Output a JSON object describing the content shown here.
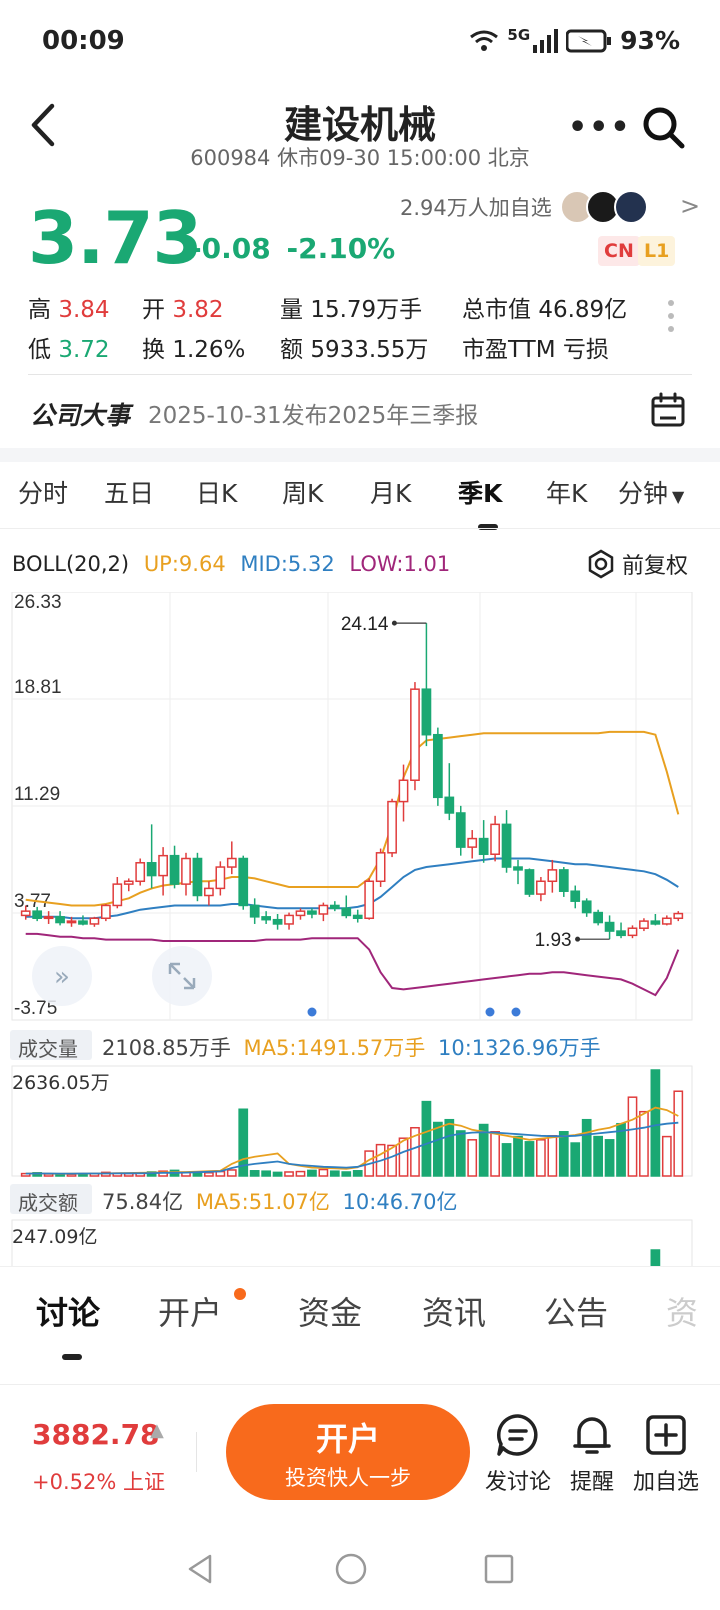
{
  "status": {
    "time": "00:09",
    "network": "5G",
    "battery": "93%"
  },
  "header": {
    "title": "建设机械",
    "subtitle": "600984 休市09-30 15:00:00 北京"
  },
  "quote": {
    "price": "3.73",
    "change": "-0.08",
    "change_pct": "-2.10%",
    "followers": "2.94万人加自选",
    "tags": [
      "CN",
      "L1"
    ]
  },
  "stats": [
    {
      "label": "高",
      "value": "3.84",
      "color": "red"
    },
    {
      "label": "开",
      "value": "3.82",
      "color": "red"
    },
    {
      "label": "量",
      "value": "15.79万手",
      "color": "dark"
    },
    {
      "label": "总市值",
      "value": "46.89亿",
      "color": "dark"
    },
    {
      "label": "低",
      "value": "3.72",
      "color": "green"
    },
    {
      "label": "换",
      "value": "1.26%",
      "color": "dark"
    },
    {
      "label": "额",
      "value": "5933.55万",
      "color": "dark"
    },
    {
      "label": "市盈TTM",
      "value": "亏损",
      "color": "dark"
    }
  ],
  "event": {
    "title": "公司大事",
    "text": "2025-10-31发布2025年三季报"
  },
  "period_tabs": [
    "分时",
    "五日",
    "日K",
    "周K",
    "月K",
    "季K",
    "年K",
    "分钟"
  ],
  "active_period": "季K",
  "indicator": {
    "name": "BOLL(20,2)",
    "up": "UP:9.64",
    "mid": "MID:5.32",
    "low": "LOW:1.01",
    "adjust": "前复权"
  },
  "colors": {
    "up": "#e03c3c",
    "down": "#1aa873",
    "boll_up": "#e8a020",
    "boll_mid": "#2f7fc1",
    "boll_low": "#a0267a",
    "accent": "#f86a1c"
  },
  "chart_data": {
    "type": "candlestick",
    "y_ticks": [
      "26.33",
      "18.81",
      "11.29",
      "3.77",
      "-3.75"
    ],
    "ylim": [
      -3.75,
      26.33
    ],
    "annotations": [
      {
        "label": "24.14",
        "kind": "high"
      },
      {
        "label": "1.93",
        "kind": "low"
      }
    ],
    "candles": [
      {
        "o": 3.6,
        "h": 4.3,
        "l": 3.3,
        "c": 3.9
      },
      {
        "o": 3.9,
        "h": 4.2,
        "l": 3.2,
        "c": 3.4
      },
      {
        "o": 3.4,
        "h": 3.9,
        "l": 3.0,
        "c": 3.5
      },
      {
        "o": 3.5,
        "h": 3.9,
        "l": 2.9,
        "c": 3.1
      },
      {
        "o": 3.1,
        "h": 3.5,
        "l": 2.8,
        "c": 3.2
      },
      {
        "o": 3.2,
        "h": 3.6,
        "l": 2.9,
        "c": 3.0
      },
      {
        "o": 3.0,
        "h": 3.5,
        "l": 2.8,
        "c": 3.4
      },
      {
        "o": 3.4,
        "h": 4.4,
        "l": 3.2,
        "c": 4.3
      },
      {
        "o": 4.3,
        "h": 6.3,
        "l": 4.1,
        "c": 5.8
      },
      {
        "o": 5.8,
        "h": 6.2,
        "l": 5.3,
        "c": 6.0
      },
      {
        "o": 6.0,
        "h": 7.6,
        "l": 5.7,
        "c": 7.3
      },
      {
        "o": 7.3,
        "h": 10.0,
        "l": 5.5,
        "c": 6.4
      },
      {
        "o": 6.4,
        "h": 8.4,
        "l": 5.0,
        "c": 7.8
      },
      {
        "o": 7.8,
        "h": 8.5,
        "l": 5.5,
        "c": 5.8
      },
      {
        "o": 5.8,
        "h": 8.0,
        "l": 5.0,
        "c": 7.6
      },
      {
        "o": 7.6,
        "h": 8.0,
        "l": 4.6,
        "c": 5.0
      },
      {
        "o": 5.0,
        "h": 6.0,
        "l": 4.3,
        "c": 5.5
      },
      {
        "o": 5.5,
        "h": 7.4,
        "l": 5.0,
        "c": 7.0
      },
      {
        "o": 7.0,
        "h": 8.8,
        "l": 6.5,
        "c": 7.6
      },
      {
        "o": 7.6,
        "h": 7.8,
        "l": 4.0,
        "c": 4.3
      },
      {
        "o": 4.3,
        "h": 4.8,
        "l": 3.0,
        "c": 3.5
      },
      {
        "o": 3.5,
        "h": 3.9,
        "l": 3.0,
        "c": 3.3
      },
      {
        "o": 3.3,
        "h": 3.7,
        "l": 2.6,
        "c": 3.0
      },
      {
        "o": 3.0,
        "h": 3.8,
        "l": 2.6,
        "c": 3.6
      },
      {
        "o": 3.6,
        "h": 4.1,
        "l": 3.3,
        "c": 3.9
      },
      {
        "o": 3.9,
        "h": 4.1,
        "l": 3.4,
        "c": 3.7
      },
      {
        "o": 3.7,
        "h": 4.5,
        "l": 3.2,
        "c": 4.3
      },
      {
        "o": 4.3,
        "h": 4.6,
        "l": 3.9,
        "c": 4.1
      },
      {
        "o": 4.1,
        "h": 5.0,
        "l": 3.4,
        "c": 3.6
      },
      {
        "o": 3.6,
        "h": 4.0,
        "l": 3.1,
        "c": 3.4
      },
      {
        "o": 3.4,
        "h": 6.2,
        "l": 3.3,
        "c": 6.0
      },
      {
        "o": 6.0,
        "h": 8.3,
        "l": 5.6,
        "c": 8.0
      },
      {
        "o": 8.0,
        "h": 11.8,
        "l": 7.7,
        "c": 11.6
      },
      {
        "o": 11.6,
        "h": 14.2,
        "l": 10.2,
        "c": 13.1
      },
      {
        "o": 13.1,
        "h": 20.0,
        "l": 12.4,
        "c": 19.5
      },
      {
        "o": 19.5,
        "h": 24.14,
        "l": 15.5,
        "c": 16.3
      },
      {
        "o": 16.3,
        "h": 16.8,
        "l": 11.3,
        "c": 11.9
      },
      {
        "o": 11.9,
        "h": 14.3,
        "l": 10.3,
        "c": 10.8
      },
      {
        "o": 10.8,
        "h": 11.3,
        "l": 7.8,
        "c": 8.4
      },
      {
        "o": 8.4,
        "h": 9.6,
        "l": 7.6,
        "c": 9.0
      },
      {
        "o": 9.0,
        "h": 10.3,
        "l": 7.3,
        "c": 7.9
      },
      {
        "o": 7.9,
        "h": 10.6,
        "l": 7.4,
        "c": 10.0
      },
      {
        "o": 10.0,
        "h": 11.0,
        "l": 6.6,
        "c": 7.0
      },
      {
        "o": 7.0,
        "h": 7.5,
        "l": 5.8,
        "c": 6.8
      },
      {
        "o": 6.8,
        "h": 6.9,
        "l": 4.9,
        "c": 5.1
      },
      {
        "o": 5.1,
        "h": 6.3,
        "l": 4.6,
        "c": 6.0
      },
      {
        "o": 6.0,
        "h": 7.5,
        "l": 5.2,
        "c": 6.8
      },
      {
        "o": 6.8,
        "h": 7.0,
        "l": 4.9,
        "c": 5.3
      },
      {
        "o": 5.3,
        "h": 5.7,
        "l": 4.1,
        "c": 4.6
      },
      {
        "o": 4.6,
        "h": 4.8,
        "l": 3.5,
        "c": 3.8
      },
      {
        "o": 3.8,
        "h": 4.0,
        "l": 2.9,
        "c": 3.1
      },
      {
        "o": 3.1,
        "h": 3.6,
        "l": 1.93,
        "c": 2.5
      },
      {
        "o": 2.5,
        "h": 3.1,
        "l": 2.0,
        "c": 2.2
      },
      {
        "o": 2.2,
        "h": 2.9,
        "l": 2.0,
        "c": 2.7
      },
      {
        "o": 2.7,
        "h": 3.4,
        "l": 2.5,
        "c": 3.2
      },
      {
        "o": 3.2,
        "h": 3.7,
        "l": 2.9,
        "c": 3.0
      },
      {
        "o": 3.0,
        "h": 3.6,
        "l": 2.9,
        "c": 3.4
      },
      {
        "o": 3.4,
        "h": 3.9,
        "l": 3.2,
        "c": 3.73
      }
    ],
    "boll_up": [
      4.7,
      4.6,
      4.5,
      4.4,
      4.3,
      4.3,
      4.3,
      4.4,
      4.6,
      4.8,
      5.2,
      5.5,
      5.7,
      5.8,
      5.9,
      6.0,
      6.0,
      6.1,
      6.3,
      6.3,
      6.2,
      6.0,
      5.8,
      5.6,
      5.6,
      5.6,
      5.6,
      5.6,
      5.6,
      5.6,
      6.2,
      7.6,
      10.0,
      13.3,
      15.2,
      15.9,
      16.0,
      16.1,
      16.2,
      16.3,
      16.4,
      16.4,
      16.4,
      16.4,
      16.4,
      16.4,
      16.4,
      16.4,
      16.4,
      16.4,
      16.4,
      16.5,
      16.5,
      16.5,
      16.5,
      16.3,
      13.7,
      10.7
    ],
    "boll_mid": [
      3.5,
      3.5,
      3.5,
      3.5,
      3.4,
      3.4,
      3.4,
      3.5,
      3.6,
      3.8,
      4.0,
      4.1,
      4.2,
      4.3,
      4.3,
      4.3,
      4.3,
      4.3,
      4.4,
      4.4,
      4.3,
      4.2,
      4.1,
      4.1,
      4.1,
      4.1,
      4.1,
      4.1,
      4.1,
      4.2,
      4.4,
      4.9,
      5.6,
      6.3,
      6.8,
      7.0,
      7.1,
      7.2,
      7.3,
      7.4,
      7.5,
      7.6,
      7.6,
      7.6,
      7.6,
      7.5,
      7.4,
      7.3,
      7.2,
      7.2,
      7.1,
      7.0,
      6.9,
      6.8,
      6.7,
      6.5,
      6.1,
      5.6
    ],
    "boll_low": [
      2.3,
      2.3,
      2.2,
      2.1,
      2.1,
      2.0,
      2.0,
      1.9,
      1.9,
      1.9,
      1.9,
      1.9,
      1.8,
      1.8,
      1.8,
      1.8,
      1.8,
      1.8,
      1.8,
      1.8,
      1.8,
      1.9,
      1.9,
      1.9,
      1.9,
      2.0,
      2.0,
      2.0,
      2.0,
      2.0,
      1.2,
      -0.4,
      -1.5,
      -1.6,
      -1.5,
      -1.4,
      -1.3,
      -1.2,
      -1.1,
      -1.0,
      -0.9,
      -0.8,
      -0.7,
      -0.6,
      -0.5,
      -0.5,
      -0.4,
      -0.4,
      -0.5,
      -0.6,
      -0.7,
      -0.8,
      -0.9,
      -1.2,
      -1.6,
      -2.0,
      -0.8,
      1.2
    ],
    "volume": {
      "label": "成交量",
      "value": "2108.85万手",
      "ma5": "MA5:1491.57万手",
      "ma10": "10:1326.96万手",
      "y_top": "2636.05万",
      "bars": [
        60,
        80,
        50,
        40,
        45,
        50,
        60,
        90,
        70,
        60,
        80,
        100,
        120,
        140,
        90,
        70,
        80,
        110,
        150,
        1660,
        130,
        120,
        90,
        100,
        110,
        140,
        160,
        120,
        100,
        130,
        620,
        780,
        760,
        940,
        1200,
        1850,
        1330,
        1400,
        1120,
        900,
        1280,
        1100,
        800,
        980,
        850,
        900,
        1000,
        1100,
        820,
        1400,
        980,
        900,
        1300,
        1960,
        1600,
        2636,
        980,
        2108
      ],
      "ma5_line": [
        60,
        65,
        60,
        55,
        58,
        60,
        62,
        65,
        70,
        75,
        80,
        85,
        90,
        95,
        100,
        110,
        120,
        130,
        300,
        420,
        480,
        520,
        560,
        300,
        250,
        210,
        200,
        190,
        180,
        220,
        400,
        540,
        700,
        880,
        1000,
        1100,
        1200,
        1300,
        1250,
        1150,
        1100,
        1050,
        1000,
        950,
        900,
        930,
        960,
        990,
        1020,
        1080,
        1150,
        1200,
        1300,
        1400,
        1550,
        1700,
        1640,
        1491
      ],
      "ma10_line": [
        60,
        62,
        61,
        60,
        60,
        61,
        62,
        63,
        64,
        66,
        68,
        72,
        76,
        80,
        85,
        95,
        105,
        115,
        200,
        260,
        300,
        330,
        360,
        300,
        270,
        250,
        230,
        220,
        210,
        230,
        300,
        380,
        480,
        600,
        700,
        800,
        900,
        1000,
        1050,
        1080,
        1090,
        1080,
        1060,
        1040,
        1020,
        1000,
        990,
        990,
        1000,
        1030,
        1060,
        1090,
        1120,
        1160,
        1200,
        1260,
        1300,
        1326
      ]
    },
    "amount": {
      "label": "成交额",
      "value": "75.84亿",
      "ma5": "MA5:51.07亿",
      "ma10": "10:46.70亿",
      "y_top": "247.09亿"
    }
  },
  "bottom_tabs": [
    "讨论",
    "开户",
    "资金",
    "资讯",
    "公告",
    "资"
  ],
  "active_bottom_tab": "讨论",
  "index": {
    "value": "3882.78",
    "change": "+0.52% 上证"
  },
  "open_account": {
    "title": "开户",
    "subtitle": "投资快人一步"
  },
  "footer_actions": [
    "发讨论",
    "提醒",
    "加自选"
  ]
}
